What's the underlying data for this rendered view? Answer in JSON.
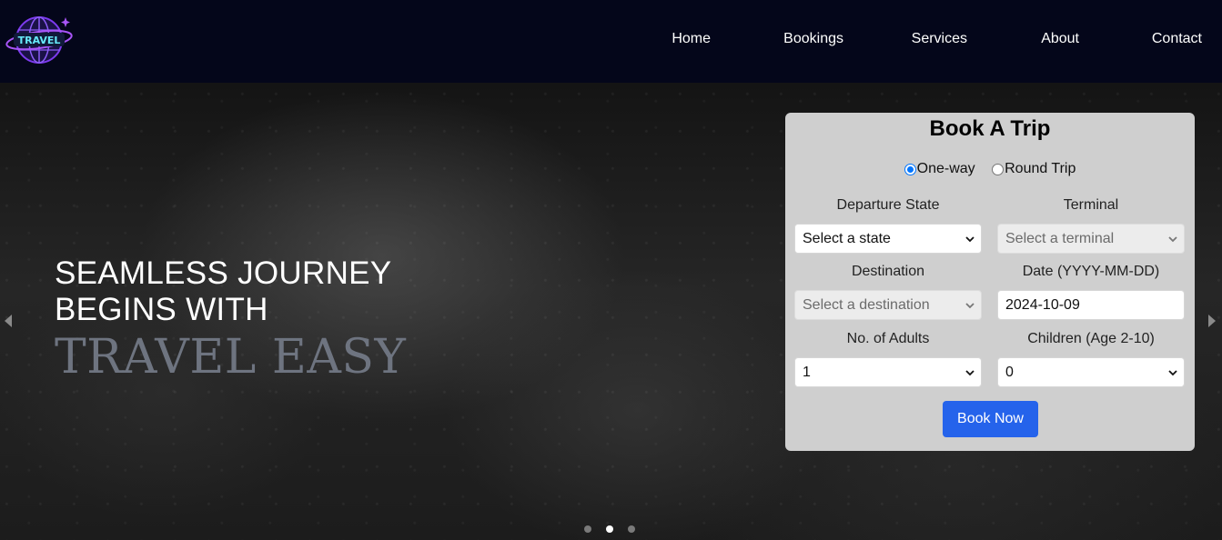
{
  "navbar": {
    "logo_text": "TRAVEL",
    "links": [
      "Home",
      "Bookings",
      "Services",
      "About",
      "Contact"
    ]
  },
  "hero": {
    "line1": "SEAMLESS JOURNEY",
    "line2": "BEGINS WITH",
    "brand": "TRAVEL EASY",
    "carousel_active_index": 1,
    "carousel_count": 3
  },
  "booking": {
    "title": "Book A Trip",
    "trip_types": [
      {
        "label": "One-way",
        "checked": true
      },
      {
        "label": "Round Trip",
        "checked": false
      }
    ],
    "departure_state": {
      "label": "Departure State",
      "value": "Select a state"
    },
    "terminal": {
      "label": "Terminal",
      "value": "Select a terminal"
    },
    "destination": {
      "label": "Destination",
      "value": "Select a destination"
    },
    "date": {
      "label": "Date (YYYY-MM-DD)",
      "value": "2024-10-09"
    },
    "adults": {
      "label": "No. of Adults",
      "value": "1"
    },
    "children": {
      "label": "Children (Age 2-10)",
      "value": "0"
    },
    "submit_label": "Book Now"
  },
  "colors": {
    "nav_bg": "#04061a",
    "card_bg": "#cfcfcf",
    "button_bg": "#2563eb",
    "brand_text": "#6e7480",
    "logo_purple": "#7c3aed",
    "logo_cyan": "#67e8f9"
  }
}
